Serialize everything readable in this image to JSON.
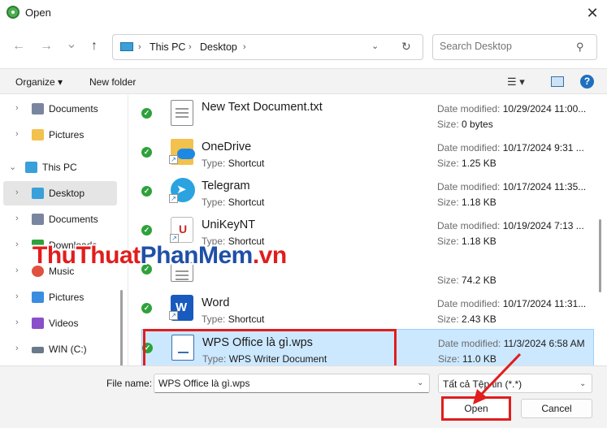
{
  "window": {
    "title": "Open",
    "close_glyph": "✕"
  },
  "nav": {
    "back": "←",
    "forward": "→",
    "history": "⌄",
    "up": "↑"
  },
  "address": {
    "segments": [
      "This PC",
      "Desktop"
    ]
  },
  "search": {
    "placeholder": "Search Desktop"
  },
  "toolbar": {
    "organize": "Organize ▾",
    "new_folder": "New folder"
  },
  "sidebar": {
    "items": [
      {
        "label": "Documents",
        "icon": "documents-icon",
        "color": "#7a86a0"
      },
      {
        "label": "Pictures",
        "icon": "folder-icon",
        "color": "#f2c14e"
      },
      {
        "label": "This PC",
        "icon": "pc-icon",
        "color": "#39a0d9"
      },
      {
        "label": "Desktop",
        "icon": "desktop-icon",
        "color": "#39a0d9"
      },
      {
        "label": "Documents",
        "icon": "documents-icon",
        "color": "#7a86a0"
      },
      {
        "label": "Downloads",
        "icon": "downloads-icon",
        "color": "#2da23a"
      },
      {
        "label": "Music",
        "icon": "music-icon",
        "color": "#e0523f"
      },
      {
        "label": "Pictures",
        "icon": "pictures-icon",
        "color": "#3a8de0"
      },
      {
        "label": "Videos",
        "icon": "videos-icon",
        "color": "#8a4fc9"
      },
      {
        "label": "WIN (C:)",
        "icon": "drive-icon",
        "color": "#6a7a8a"
      }
    ]
  },
  "files": [
    {
      "name": "New Text Document.txt",
      "type_label": "",
      "type": "",
      "modified": "10/29/2024 11:00...",
      "size": "0 bytes",
      "icon": "text-document-icon"
    },
    {
      "name": "OneDrive",
      "type_label": "Type:",
      "type": "Shortcut",
      "modified": "10/17/2024 9:31 ...",
      "size": "1.25 KB",
      "icon": "onedrive-icon"
    },
    {
      "name": "Telegram",
      "type_label": "Type:",
      "type": "Shortcut",
      "modified": "10/17/2024 11:35...",
      "size": "1.18 KB",
      "icon": "telegram-icon"
    },
    {
      "name": "UniKeyNT",
      "type_label": "Type:",
      "type": "Shortcut",
      "modified": "10/19/2024 7:13 ...",
      "size": "1.18 KB",
      "icon": "unikey-icon"
    },
    {
      "name": "",
      "type_label": "",
      "type": "",
      "modified": "",
      "size": "74.2 KB",
      "icon": "document-icon"
    },
    {
      "name": "Word",
      "type_label": "Type:",
      "type": "Shortcut",
      "modified": "10/17/2024 11:31...",
      "size": "2.43 KB",
      "icon": "word-icon"
    },
    {
      "name": "WPS Office là gì.wps",
      "type_label": "Type:",
      "type": "WPS Writer Document",
      "modified": "11/3/2024 6:58 AM",
      "size": "11.0 KB",
      "icon": "wps-document-icon"
    }
  ],
  "labels": {
    "date_modified": "Date modified:",
    "size": "Size:",
    "type": "Type:"
  },
  "footer": {
    "file_name_label": "File name:",
    "file_name_value": "WPS Office là gì.wps",
    "filter_value": "Tất cả Tệp tin (*.*)",
    "open_label": "Open",
    "cancel_label": "Cancel"
  },
  "watermark": {
    "part1": "ThuThuat",
    "part2": "PhanMem",
    "part3": ".vn"
  },
  "colors": {
    "accent": "#0067c0",
    "highlight": "#e11d1d",
    "selection": "#cce8ff",
    "sync_check": "#2da23a"
  }
}
